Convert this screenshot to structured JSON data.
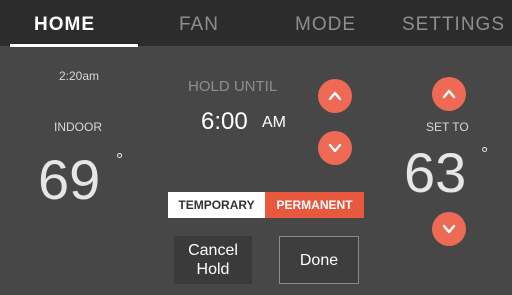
{
  "tabs": {
    "home": "HOME",
    "fan": "FAN",
    "mode": "MODE",
    "settings": "SETTINGS"
  },
  "status": {
    "time": "2:20am",
    "indoor_label": "INDOOR",
    "indoor_temp": "69",
    "degree": "°"
  },
  "hold": {
    "label": "HOLD UNTIL",
    "time": "6:00",
    "ampm": "AM"
  },
  "setpoint": {
    "label": "SET TO",
    "temp": "63",
    "degree": "°"
  },
  "hold_type": {
    "temporary": "TEMPORARY",
    "permanent": "PERMANENT"
  },
  "buttons": {
    "cancel_line1": "Cancel",
    "cancel_line2": "Hold",
    "done": "Done"
  },
  "colors": {
    "accent": "#ee6a55",
    "tab_bar": "#2c2c2c",
    "screen_bg": "#474747"
  },
  "icons": {
    "up": "chevron-up-icon",
    "down": "chevron-down-icon"
  }
}
